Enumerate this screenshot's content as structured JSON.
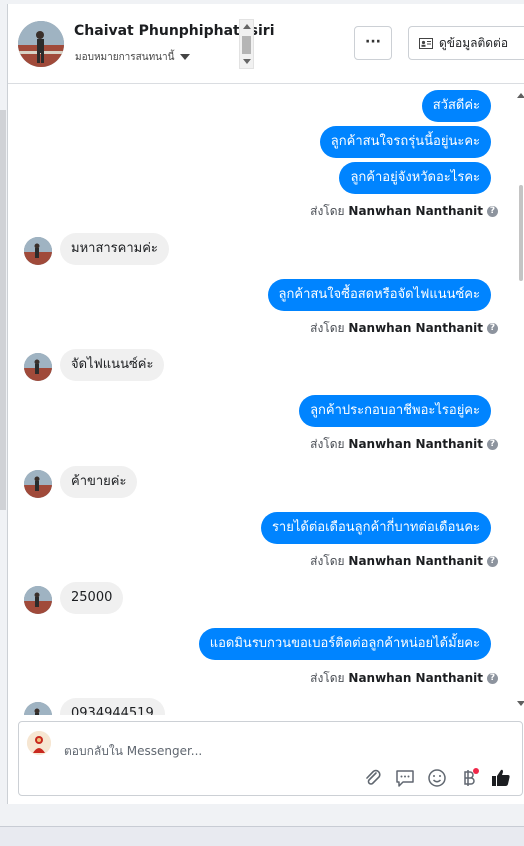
{
  "header": {
    "contact_name": "Chaivat Phunphiphatnsiri",
    "assign_label": "มอบหมายการสนทนานี้",
    "more_label": "···",
    "info_button_label": "ดูข้อมูลติดต่อ"
  },
  "messages": [
    {
      "dir": "out",
      "text": "สวัสดีค่ะ"
    },
    {
      "dir": "out",
      "text": "ลูกค้าสนใจรถรุ่นนี้อยู่นะคะ"
    },
    {
      "dir": "out",
      "text": "ลูกค้าอยู่จังหวัดอะไรคะ"
    },
    {
      "dir": "meta",
      "prefix": "ส่งโดย",
      "sender": "Nanwhan Nanthanit"
    },
    {
      "dir": "in",
      "text": "มหาสารคามค่ะ"
    },
    {
      "dir": "out",
      "text": "ลูกค้าสนใจซื้อสดหรือจัดไฟแนนซ์คะ"
    },
    {
      "dir": "meta",
      "prefix": "ส่งโดย",
      "sender": "Nanwhan Nanthanit"
    },
    {
      "dir": "in",
      "text": "จัดไฟแนนซ์ค่ะ"
    },
    {
      "dir": "out",
      "text": "ลูกค้าประกอบอาชีพอะไรอยู่คะ"
    },
    {
      "dir": "meta",
      "prefix": "ส่งโดย",
      "sender": "Nanwhan Nanthanit"
    },
    {
      "dir": "in",
      "text": "ค้าขายค่ะ"
    },
    {
      "dir": "out",
      "text": "รายได้ต่อเดือนลูกค้ากี่บาทต่อเดือนคะ"
    },
    {
      "dir": "meta",
      "prefix": "ส่งโดย",
      "sender": "Nanwhan Nanthanit"
    },
    {
      "dir": "in",
      "text": "25000"
    },
    {
      "dir": "out",
      "text": "แอดมินรบกวนขอเบอร์ติดต่อลูกค้าหน่อยได้มั้ยคะ"
    },
    {
      "dir": "meta",
      "prefix": "ส่งโดย",
      "sender": "Nanwhan Nanthanit"
    },
    {
      "dir": "in",
      "text": "0934944519"
    }
  ],
  "composer": {
    "placeholder": "ตอบกลับใน Messenger...",
    "tool_icons": [
      "paperclip-icon",
      "speech-bubble-icon",
      "emoji-icon",
      "baht-payment-icon",
      "thumbs-up-icon"
    ]
  },
  "colors": {
    "outgoing_bubble": "#0084ff",
    "incoming_bubble": "#f0f0f0",
    "like_icon": "#1c1e21",
    "notify_dot": "#f02849"
  }
}
